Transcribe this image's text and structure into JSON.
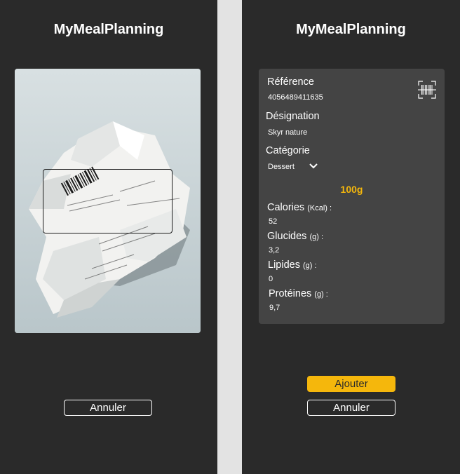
{
  "app": {
    "title": "MyMealPlanning"
  },
  "scanner": {
    "cancel_label": "Annuler"
  },
  "product": {
    "reference_label": "Référence",
    "reference_value": "4056489411635",
    "designation_label": "Désignation",
    "designation_value": "Skyr nature",
    "category_label": "Catégorie",
    "category_value": "Dessert",
    "portion_label": "100g",
    "nutrients": [
      {
        "label": "Calories",
        "unit": "(Kcal) :",
        "value": "52"
      },
      {
        "label": "Glucides",
        "unit": "(g) :",
        "value": "3,2"
      },
      {
        "label": "Lipides",
        "unit": "(g) :",
        "value": "0"
      },
      {
        "label": "Protéines",
        "unit": "(g) :",
        "value": "9,7"
      }
    ],
    "add_label": "Ajouter",
    "cancel_label": "Annuler"
  },
  "colors": {
    "background": "#2a2a2a",
    "card": "#444444",
    "accent": "#f5b70c",
    "divider": "#e3e3e3"
  },
  "icons": [
    "barcode-scan-icon",
    "chevron-down-icon"
  ]
}
